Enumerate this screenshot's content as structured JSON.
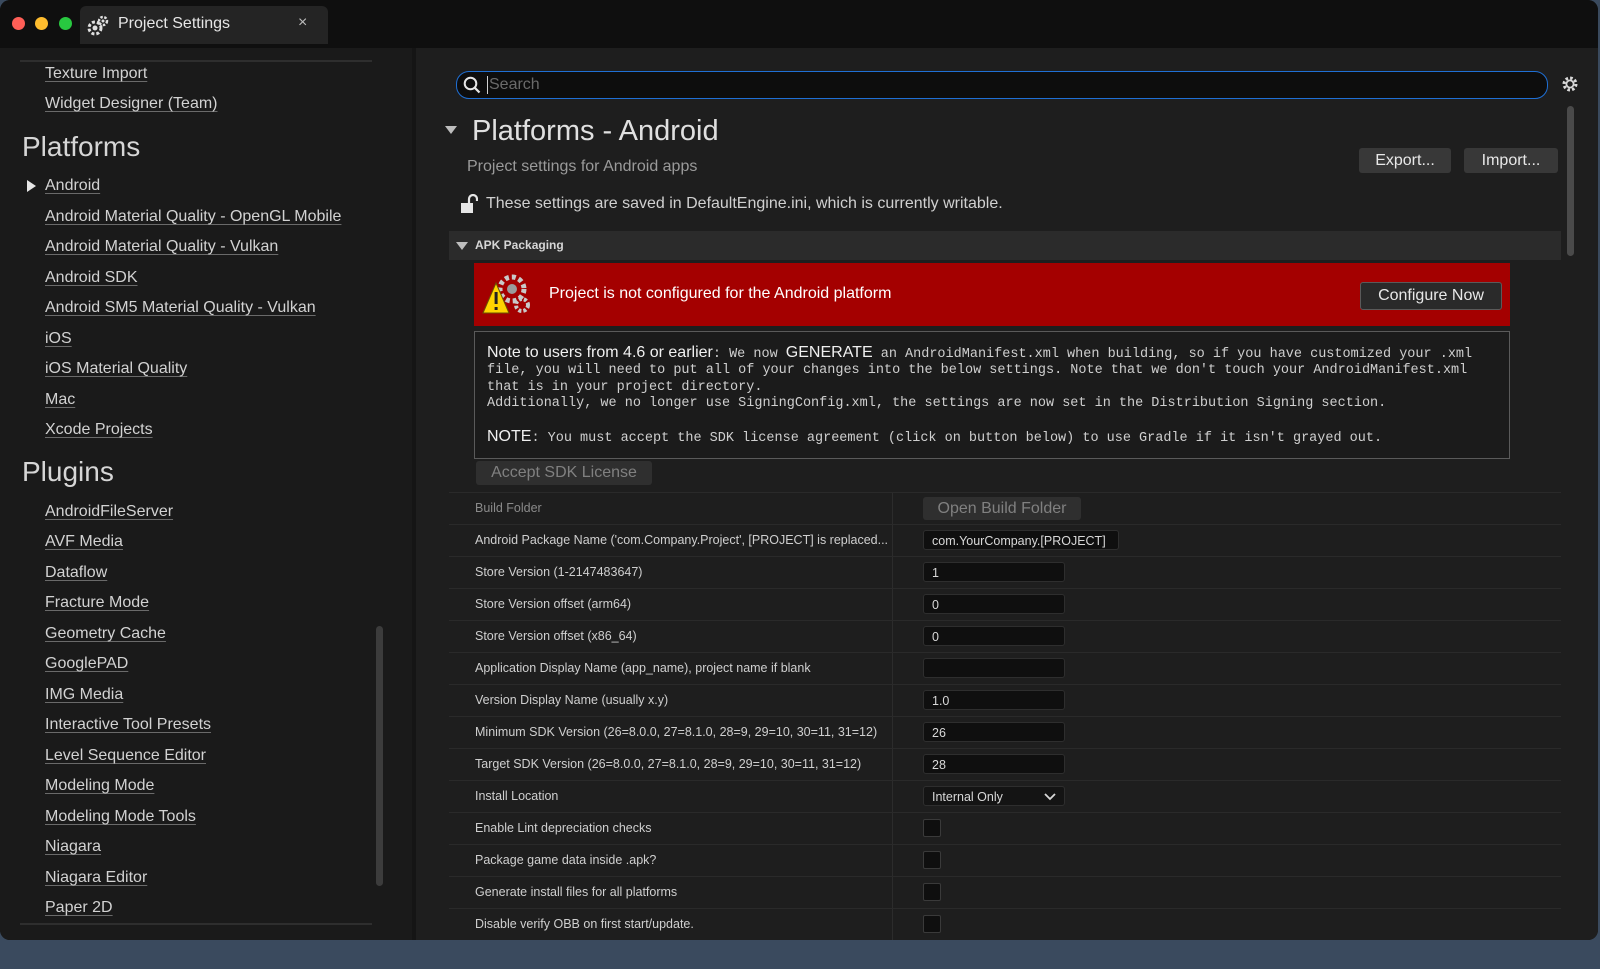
{
  "window": {
    "tab_title": "Project Settings",
    "tab_close": "×",
    "traffic_lights": {
      "close": "#ff5f57",
      "minimize": "#febc2e",
      "maximize": "#28c840"
    }
  },
  "sidebar": {
    "top_items": [
      {
        "label": "Texture Import"
      },
      {
        "label": "Widget Designer (Team)"
      }
    ],
    "platforms_heading": "Platforms",
    "platform_items": [
      {
        "label": "Android"
      },
      {
        "label": "Android Material Quality - OpenGL Mobile"
      },
      {
        "label": "Android Material Quality - Vulkan"
      },
      {
        "label": "Android SDK"
      },
      {
        "label": "Android SM5 Material Quality - Vulkan"
      },
      {
        "label": "iOS"
      },
      {
        "label": "iOS Material Quality"
      },
      {
        "label": "Mac"
      },
      {
        "label": "Xcode Projects"
      }
    ],
    "plugins_heading": "Plugins",
    "plugin_items": [
      {
        "label": "AndroidFileServer"
      },
      {
        "label": "AVF Media"
      },
      {
        "label": "Dataflow"
      },
      {
        "label": "Fracture Mode"
      },
      {
        "label": "Geometry Cache"
      },
      {
        "label": "GooglePAD"
      },
      {
        "label": "IMG Media"
      },
      {
        "label": "Interactive Tool Presets"
      },
      {
        "label": "Level Sequence Editor"
      },
      {
        "label": "Modeling Mode"
      },
      {
        "label": "Modeling Mode Tools"
      },
      {
        "label": "Niagara"
      },
      {
        "label": "Niagara Editor"
      },
      {
        "label": "Paper 2D"
      }
    ]
  },
  "main": {
    "search_placeholder": "Search",
    "title": "Platforms - Android",
    "subtitle": "Project settings for Android apps",
    "export_label": "Export...",
    "import_label": "Import...",
    "saved_text": "These settings are saved in DefaultEngine.ini, which is currently writable.",
    "category_label": "APK Packaging",
    "banner_text": "Project is not configured for the Android platform",
    "configure_label": "Configure Now",
    "accent_red": "#a40000",
    "accent_blue": "#1f6fd4",
    "note": {
      "lead": "Note to users from 4.6 or earlier",
      "line1_a": ": We now ",
      "generate": "GENERATE",
      "line1_b": " an AndroidManifest.xml when building, so if you have customized your .xml",
      "line2": "file, you will need to put all of your changes into the below settings. Note that we don't touch your AndroidManifest.xml",
      "line3": "that is in your project directory.",
      "line4": "Additionally, we no longer use SigningConfig.xml, the settings are now set in the Distribution Signing section.",
      "note_lead": "NOTE",
      "note_rest": ": You must accept the SDK license agreement (click on button below) to use Gradle if it isn't grayed out."
    },
    "accept_license_label": "Accept SDK License",
    "build_folder_label": "Build Folder",
    "open_build_folder_label": "Open Build Folder",
    "rows": [
      {
        "label": "Android Package Name ('com.Company.Project', [PROJECT] is replaced...",
        "value": "com.YourCompany.[PROJECT]"
      },
      {
        "label": "Store Version (1-2147483647)",
        "value": "1"
      },
      {
        "label": "Store Version offset (arm64)",
        "value": "0"
      },
      {
        "label": "Store Version offset (x86_64)",
        "value": "0"
      },
      {
        "label": "Application Display Name (app_name), project name if blank",
        "value": ""
      },
      {
        "label": "Version Display Name (usually x.y)",
        "value": "1.0"
      },
      {
        "label": "Minimum SDK Version (26=8.0.0, 27=8.1.0, 28=9, 29=10, 30=11, 31=12)",
        "value": "26"
      },
      {
        "label": "Target SDK Version (26=8.0.0, 27=8.1.0, 28=9, 29=10, 30=11, 31=12)",
        "value": "28"
      }
    ],
    "install_location_label": "Install Location",
    "install_location_value": "Internal Only",
    "checkbox_rows": [
      {
        "label": "Enable Lint depreciation checks"
      },
      {
        "label": "Package game data inside .apk?"
      },
      {
        "label": "Generate install files for all platforms"
      },
      {
        "label": "Disable verify OBB on first start/update."
      }
    ]
  }
}
